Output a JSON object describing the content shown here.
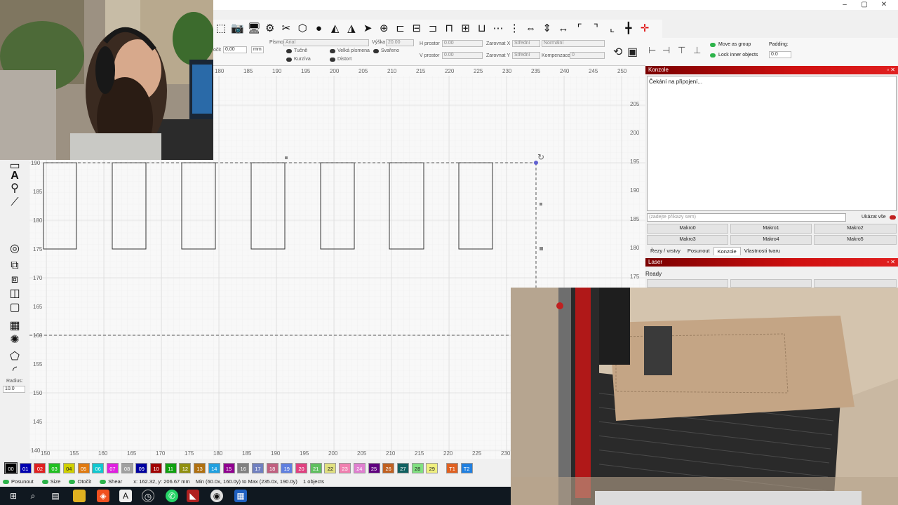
{
  "toolbar": {
    "rotate_label": "očit",
    "rotate_value": "0,00",
    "unit": "mm",
    "font_label": "Písmo",
    "font_value": "Arial",
    "height_label": "Výška",
    "height_value": "20.00",
    "h_space_label": "H prostor",
    "h_space_value": "0.00",
    "v_space_label": "V prostor",
    "v_space_value": "0.00",
    "align_x_label": "Zarovnat X",
    "align_x_value": "Střední",
    "align_y_label": "Zarovnat Y",
    "align_y_value": "Střední",
    "normal_value": "Normální",
    "comp_label": "Kompenzace",
    "comp_value": "0",
    "bold_label": "Tučně",
    "italic_label": "Kurzíva",
    "upper_label": "Velká písmena",
    "welded_label": "Svařeno",
    "distort_label": "Distort",
    "move_group_label": "Move as group",
    "lock_inner_label": "Lock inner objects",
    "padding_label": "Padding:",
    "padding_value": "0.0"
  },
  "ruler": {
    "top": [
      "180",
      "185",
      "190",
      "195",
      "200",
      "205",
      "210",
      "215",
      "220",
      "225",
      "230",
      "235",
      "240",
      "245",
      "250"
    ],
    "bottom": [
      "150",
      "155",
      "160",
      "165",
      "170",
      "175",
      "180",
      "185",
      "190",
      "195",
      "200",
      "205",
      "210",
      "215",
      "220",
      "225",
      "230"
    ],
    "left": [
      "190",
      "185",
      "180",
      "175",
      "170",
      "165",
      "160",
      "155",
      "150",
      "145",
      "140"
    ],
    "right": [
      "205",
      "200",
      "195",
      "190",
      "185",
      "180",
      "175",
      "170"
    ]
  },
  "left_tools": {
    "radius_label": "Radius:",
    "radius_value": "10.0"
  },
  "console": {
    "title": "Konzole",
    "output": "Čekání na připojení...",
    "input_placeholder": "(zadejte příkazy sem)",
    "show_all_label": "Ukázat vše",
    "macros": [
      "Makro0",
      "Makro1",
      "Makro2",
      "Makro3",
      "Makro4",
      "Makro5"
    ],
    "tabs": [
      "Řezy / vrstvy",
      "Posunout",
      "Konzole",
      "Vlastnosti tvaru"
    ],
    "active_tab": "Konzole"
  },
  "laser": {
    "title": "Laser",
    "status": "Ready"
  },
  "palette": {
    "swatches": [
      {
        "label": "00",
        "color": "#000000"
      },
      {
        "label": "01",
        "color": "#0000b0"
      },
      {
        "label": "02",
        "color": "#e02020"
      },
      {
        "label": "03",
        "color": "#20c020"
      },
      {
        "label": "04",
        "color": "#d0d000"
      },
      {
        "label": "05",
        "color": "#e07a10"
      },
      {
        "label": "06",
        "color": "#10c8d0"
      },
      {
        "label": "07",
        "color": "#e020e0"
      },
      {
        "label": "08",
        "color": "#a0a0a0"
      },
      {
        "label": "09",
        "color": "#0000a0"
      },
      {
        "label": "10",
        "color": "#a00000"
      },
      {
        "label": "11",
        "color": "#10a010"
      },
      {
        "label": "12",
        "color": "#909010"
      },
      {
        "label": "13",
        "color": "#b07010"
      },
      {
        "label": "14",
        "color": "#20a0e0"
      },
      {
        "label": "15",
        "color": "#900090"
      },
      {
        "label": "16",
        "color": "#808080"
      },
      {
        "label": "17",
        "color": "#7080c0"
      },
      {
        "label": "18",
        "color": "#c06080"
      },
      {
        "label": "19",
        "color": "#6080e0"
      },
      {
        "label": "20",
        "color": "#e04080"
      },
      {
        "label": "21",
        "color": "#60c060"
      },
      {
        "label": "22",
        "color": "#e0e080"
      },
      {
        "label": "23",
        "color": "#f080b0"
      },
      {
        "label": "24",
        "color": "#e080d0"
      },
      {
        "label": "25",
        "color": "#600080"
      },
      {
        "label": "26",
        "color": "#c06020"
      },
      {
        "label": "27",
        "color": "#106060"
      },
      {
        "label": "28",
        "color": "#80e080"
      },
      {
        "label": "29",
        "color": "#f0f080"
      },
      {
        "label": "T1",
        "color": "#e06020"
      },
      {
        "label": "T2",
        "color": "#2080e0"
      }
    ]
  },
  "status": {
    "move": "Posunout",
    "size": "Size",
    "rotate": "Otočit",
    "shear": "Shear",
    "coords": "x: 162.32, y: 206.67 mm",
    "bounds": "Min (60.0x, 160.0y) to Max (235.0x, 190.0y)",
    "count": "1 objects"
  },
  "icons": {
    "window_min": "minimize-icon",
    "window_max": "maximize-icon",
    "window_close": "close-icon"
  }
}
